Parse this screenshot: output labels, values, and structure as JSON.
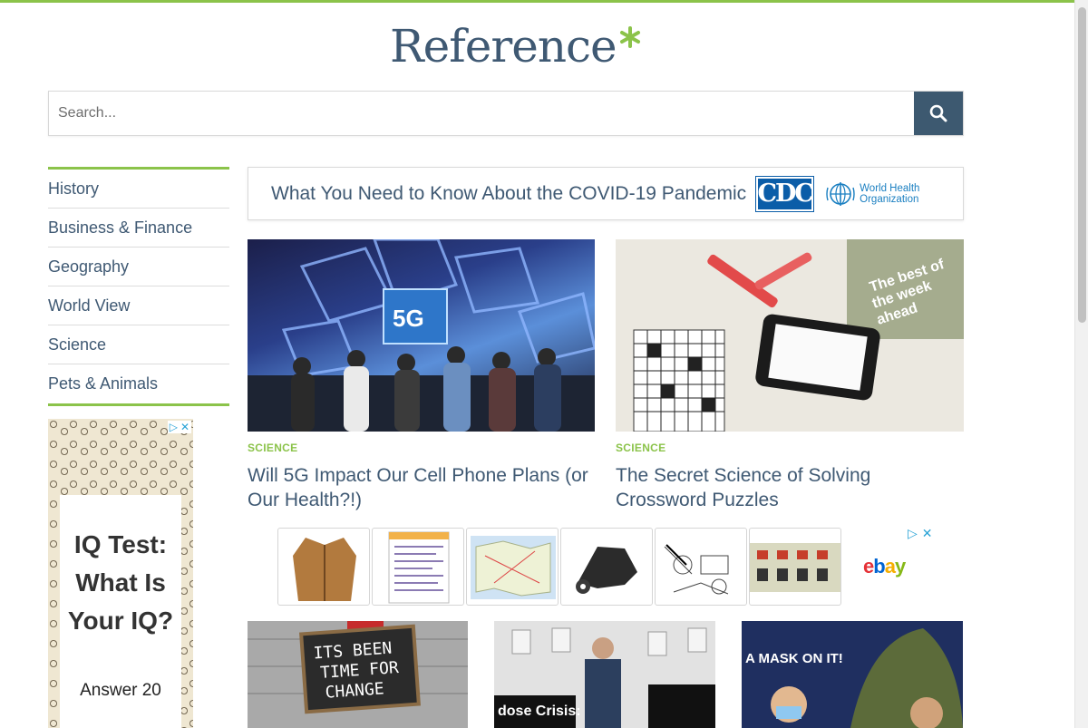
{
  "site": {
    "logo_text": "Reference"
  },
  "search": {
    "placeholder": "Search..."
  },
  "sidebar": {
    "items": [
      {
        "label": "History"
      },
      {
        "label": "Business & Finance"
      },
      {
        "label": "Geography"
      },
      {
        "label": "World View"
      },
      {
        "label": "Science"
      },
      {
        "label": "Pets & Animals"
      }
    ]
  },
  "side_ad": {
    "headline": "IQ Test: What Is Your IQ?",
    "sub": "Answer 20"
  },
  "covid_banner": {
    "text": "What You Need to Know About the COVID-19 Pandemic",
    "cdc_logo": "CDC",
    "who_line1": "World Health",
    "who_line2": "Organization"
  },
  "articles": [
    {
      "category": "SCIENCE",
      "title": "Will 5G Impact Our Cell Phone Plans (or Our Health?!)"
    },
    {
      "category": "SCIENCE",
      "title": "The Secret Science of Solving Crossword Puzzles"
    }
  ],
  "bottom_images": [
    {
      "sign_text_1": "ITS BEEN",
      "sign_text_2": "TIME FOR",
      "sign_text_3": "CHANGE"
    },
    {
      "sign_text": "dose Crisis:"
    },
    {
      "sign_text": "A MASK ON IT!"
    }
  ],
  "ad_strip": {
    "brand": "ebay"
  },
  "colors": {
    "accent_green": "#8bc34a",
    "navy": "#3d5970",
    "text": "#3f5973"
  }
}
